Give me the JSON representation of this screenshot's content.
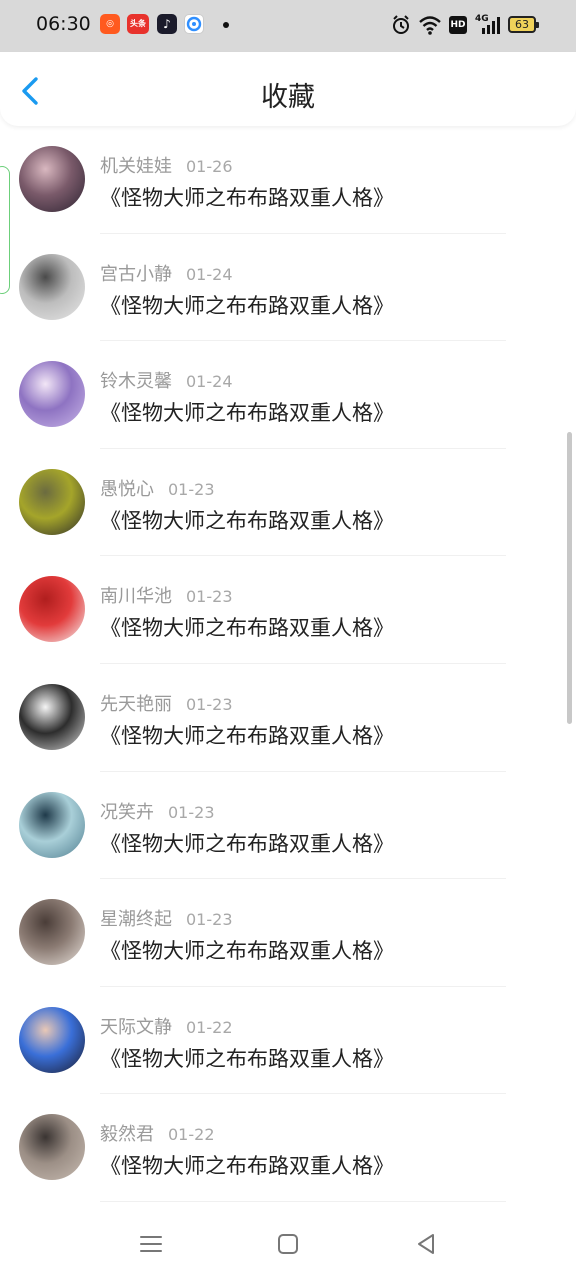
{
  "status_bar": {
    "time": "06:30",
    "apps": [
      {
        "icon": "taobao-icon",
        "text": "",
        "color": "#ff5a1f"
      },
      {
        "icon": "toutiao-icon",
        "text": "头条",
        "color": "#e8322c"
      },
      {
        "icon": "douyin-icon",
        "text": "",
        "color": "#1b1b2b"
      },
      {
        "icon": "browser-icon",
        "text": "",
        "color": "#2f8fff"
      }
    ],
    "network": "4G",
    "hd": "HD",
    "battery": "63"
  },
  "header": {
    "title": "收藏",
    "back_icon": "chevron-left-icon",
    "accent": "#1a9af0"
  },
  "items": [
    {
      "name": "机关娃娃",
      "date": "01-26",
      "content": "《怪物大师之布布路双重人格》",
      "avatar_colors": [
        "#2b2230",
        "#7a5a6a",
        "#d9b8c0"
      ]
    },
    {
      "name": "宫古小静",
      "date": "01-24",
      "content": "《怪物大师之布布路双重人格》",
      "avatar_colors": [
        "#e8e8e8",
        "#bdbdbd",
        "#4a4a4a"
      ]
    },
    {
      "name": "铃木灵馨",
      "date": "01-24",
      "content": "《怪物大师之布布路双重人格》",
      "avatar_colors": [
        "#c9b6e8",
        "#8e73c2",
        "#f2e6f6"
      ]
    },
    {
      "name": "愚悦心",
      "date": "01-23",
      "content": "《怪物大师之布布路双重人格》",
      "avatar_colors": [
        "#2a2a2a",
        "#a5a52a",
        "#6b6b40"
      ]
    },
    {
      "name": "南川华池",
      "date": "01-23",
      "content": "《怪物大师之布布路双重人格》",
      "avatar_colors": [
        "#f6f6f6",
        "#e23b3b",
        "#b01e1e"
      ]
    },
    {
      "name": "先天艳丽",
      "date": "01-23",
      "content": "《怪物大师之布布路双重人格》",
      "avatar_colors": [
        "#d8d8d8",
        "#2d2d2d",
        "#f5f5f5"
      ]
    },
    {
      "name": "况笑卉",
      "date": "01-23",
      "content": "《怪物大师之布布路双重人格》",
      "avatar_colors": [
        "#4f7d8f",
        "#a9cfd8",
        "#1f3a4a"
      ]
    },
    {
      "name": "星潮终起",
      "date": "01-23",
      "content": "《怪物大师之布布路双重人格》",
      "avatar_colors": [
        "#e9e2dc",
        "#8b7b73",
        "#4a3d38"
      ]
    },
    {
      "name": "天际文静",
      "date": "01-22",
      "content": "《怪物大师之布布路双重人格》",
      "avatar_colors": [
        "#1a1a2a",
        "#3a6fd8",
        "#e9c8b6"
      ]
    },
    {
      "name": "毅然君",
      "date": "01-22",
      "content": "《怪物大师之布布路双重人格》",
      "avatar_colors": [
        "#c8bcb2",
        "#9c8f86",
        "#3a3432"
      ]
    }
  ],
  "navbar": {
    "menu_icon": "menu-icon",
    "home_icon": "square-home-icon",
    "back_icon": "triangle-back-icon"
  }
}
